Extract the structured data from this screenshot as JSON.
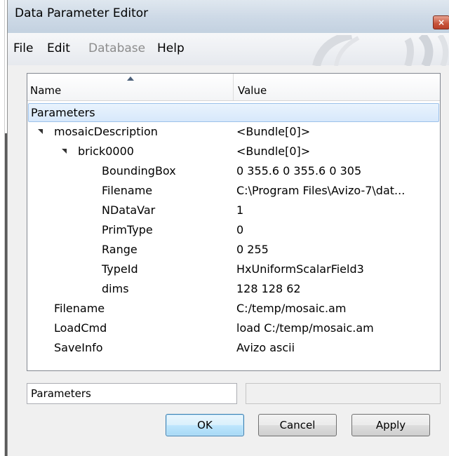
{
  "window": {
    "title": "Data Parameter Editor",
    "close_label": "×"
  },
  "menu": {
    "file": "File",
    "edit": "Edit",
    "database": "Database",
    "help": "Help"
  },
  "tree": {
    "columns": {
      "name": "Name",
      "value": "Value"
    },
    "rows": [
      {
        "name": "Parameters",
        "value": "",
        "depth": 0,
        "expander": false,
        "selected": true
      },
      {
        "name": "mosaicDescription",
        "value": "<Bundle[0]>",
        "depth": 1,
        "expander": true
      },
      {
        "name": "brick0000",
        "value": "<Bundle[0]>",
        "depth": 2,
        "expander": true
      },
      {
        "name": "BoundingBox",
        "value": "0 355.6 0 355.6 0 305",
        "depth": 3
      },
      {
        "name": "Filename",
        "value": "C:\\Program Files\\Avizo-7\\dat...",
        "depth": 3
      },
      {
        "name": "NDataVar",
        "value": "1",
        "depth": 3
      },
      {
        "name": "PrimType",
        "value": "0",
        "depth": 3
      },
      {
        "name": "Range",
        "value": "0 255",
        "depth": 3
      },
      {
        "name": "TypeId",
        "value": "HxUniformScalarField3",
        "depth": 3
      },
      {
        "name": "dims",
        "value": "128 128 62",
        "depth": 3
      },
      {
        "name": "Filename",
        "value": "C:/temp/mosaic.am",
        "depth": 1
      },
      {
        "name": "LoadCmd",
        "value": "load C:/temp/mosaic.am",
        "depth": 1
      },
      {
        "name": "SaveInfo",
        "value": "Avizo ascii",
        "depth": 1
      }
    ]
  },
  "status": {
    "path": "Parameters",
    "info": ""
  },
  "buttons": {
    "ok": "OK",
    "cancel": "Cancel",
    "apply": "Apply"
  },
  "colors": {
    "selection": "#d7e8fb",
    "titlebar": "#cdd9e6",
    "close": "#c7533a"
  }
}
